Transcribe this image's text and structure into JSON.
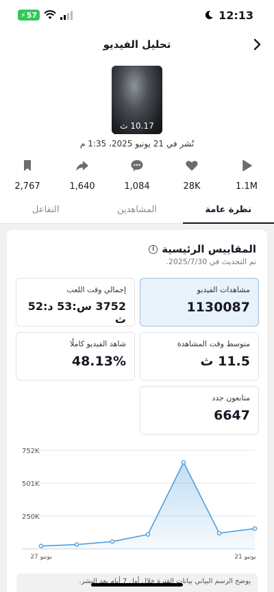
{
  "status_bar": {
    "time": "12:13",
    "battery": "57"
  },
  "header": {
    "title": "تحليل الفيديو"
  },
  "video": {
    "duration": "10.17 ث",
    "posted": "نُشر في 21 يونيو 2025، 1:35 م"
  },
  "stats": [
    {
      "icon": "play-icon",
      "value": "1.1M"
    },
    {
      "icon": "heart-icon",
      "value": "28K"
    },
    {
      "icon": "comment-icon",
      "value": "1,084"
    },
    {
      "icon": "share-icon",
      "value": "1,640"
    },
    {
      "icon": "bookmark-icon",
      "value": "2,767"
    }
  ],
  "tabs": [
    "نظرة عامة",
    "المشاهدين",
    "التفاعل"
  ],
  "metrics_section": {
    "title": "المقاييس الرئيسية",
    "updated": "تم التحديث في 2025/7/30.",
    "cards": [
      {
        "label": "مشاهدات الفيديو",
        "value": "1130087"
      },
      {
        "label": "إجمالي وقت اللعب",
        "value": "3752 س:53 د:52 ث"
      },
      {
        "label": "متوسط وقت المشاهدة",
        "value": "11.5 ث"
      },
      {
        "label": "شاهد الفيديو كاملًا",
        "value": "48.13%"
      },
      {
        "label": "متابعون جدد",
        "value": "6647"
      }
    ]
  },
  "chart_data": {
    "type": "area",
    "y_ticks": [
      "752K",
      "501K",
      "250K"
    ],
    "x_labels": {
      "left": "يونيو 27",
      "right": "يونيو 21"
    },
    "ylim": [
      0,
      752000
    ],
    "values": [
      22000,
      33000,
      56000,
      110000,
      660000,
      120000,
      155000
    ],
    "color": "#4a9fe0"
  },
  "note": "يوضح الرسم البياني بيانات الفترة خلال أول 7 أيام بعد النشر."
}
